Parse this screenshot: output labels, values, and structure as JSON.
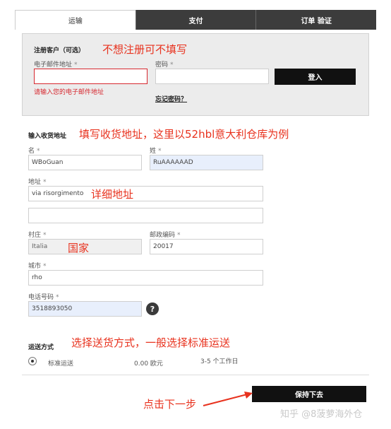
{
  "tabs": [
    {
      "label": "运输"
    },
    {
      "label": "支付"
    },
    {
      "label": "订单 验证"
    }
  ],
  "login": {
    "title": "注册客户（可选）",
    "email_label": "电子邮件地址",
    "email_value": "",
    "email_error": "请输入您的电子邮件地址",
    "password_label": "密码",
    "password_value": "",
    "login_button": "登入",
    "forgot_link": "忘记密码？"
  },
  "address": {
    "title": "输入收货地址",
    "first_name_label": "名",
    "first_name_value": "WBoGuan",
    "last_name_label": "姓",
    "last_name_value": "RuAAAAAAD",
    "street_label": "地址",
    "street_value": "via risorgimento",
    "street2_value": "",
    "country_label": "村庄",
    "country_value": "Italia",
    "postcode_label": "邮政编码",
    "postcode_value": "20017",
    "city_label": "城市",
    "city_value": "rho",
    "phone_label": "电话号码",
    "phone_value": "3518893050",
    "help_symbol": "?"
  },
  "shipping": {
    "title": "运送方式",
    "method_name": "标准运送",
    "price": "0.00 欧元",
    "delivery_time": "3-5 个工作日"
  },
  "continue_button": "保持下去",
  "annotations": {
    "login_note": "不想注册可不填写",
    "address_note": "填写收货地址，这里以52hbl意大利仓库为例",
    "street_note": "详细地址",
    "country_note": "国家",
    "shipping_note": "选择送货方式，一般选择标准运送",
    "next_note": "点击下一步"
  },
  "watermark": "知乎 @8菠萝海外仓",
  "required_mark": "*"
}
